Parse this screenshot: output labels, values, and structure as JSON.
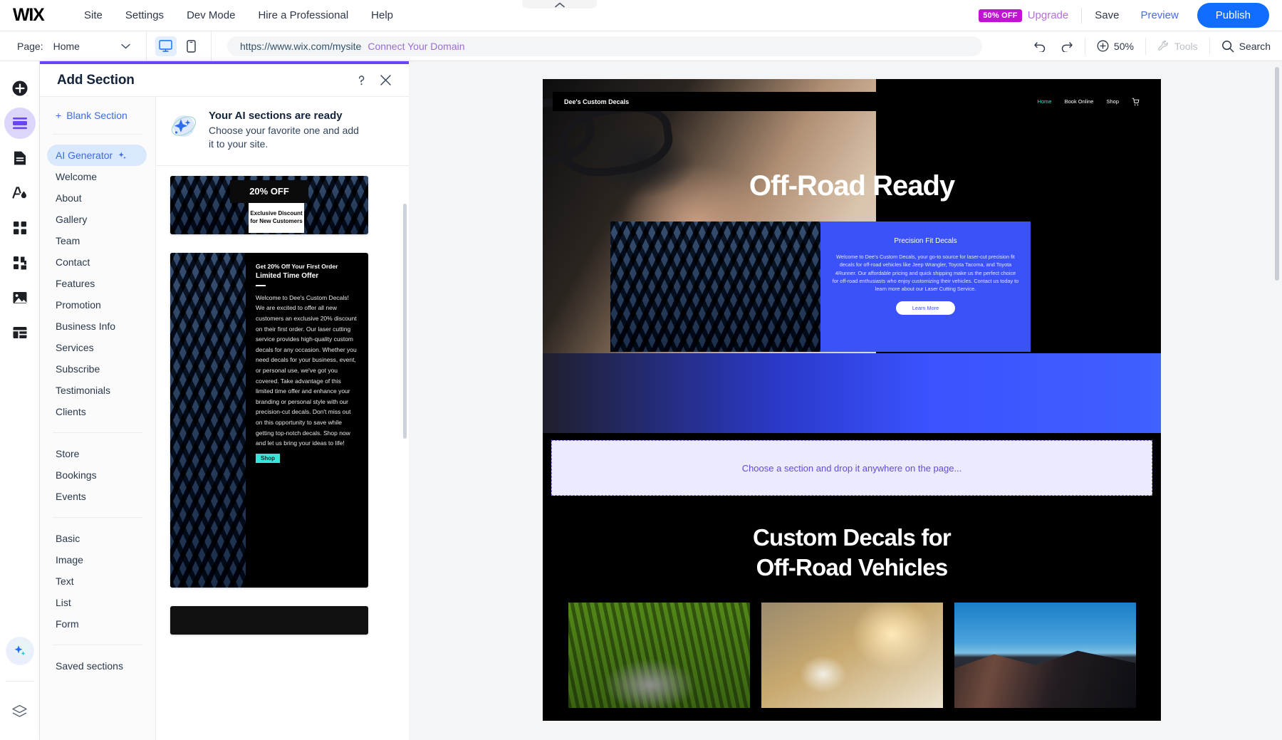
{
  "topbar": {
    "logo": "WIX",
    "menu": [
      "Site",
      "Settings",
      "Dev Mode",
      "Hire a Professional",
      "Help"
    ],
    "discount_badge": "50% OFF",
    "upgrade": "Upgrade",
    "save": "Save",
    "preview": "Preview",
    "publish": "Publish"
  },
  "subbar": {
    "page_label": "Page:",
    "page_value": "Home",
    "url": "https://www.wix.com/mysite",
    "connect_domain": "Connect Your Domain",
    "zoom": "50%",
    "tools": "Tools",
    "search": "Search"
  },
  "rail": {
    "items": [
      {
        "name": "add-icon"
      },
      {
        "name": "sections-icon"
      },
      {
        "name": "pages-icon"
      },
      {
        "name": "design-icon"
      },
      {
        "name": "apps-icon"
      },
      {
        "name": "integrations-icon"
      },
      {
        "name": "media-icon"
      },
      {
        "name": "cms-icon"
      }
    ],
    "ai_icon": "ai-sparkle-icon",
    "layers_icon": "layers-icon"
  },
  "panel": {
    "title": "Add Section",
    "help_icon": "question-mark-icon",
    "close_icon": "close-icon",
    "blank_section": "Blank Section",
    "nav_groups": [
      [
        "AI Generator",
        "Welcome",
        "About",
        "Gallery",
        "Team",
        "Contact",
        "Features",
        "Promotion",
        "Business Info",
        "Services",
        "Subscribe",
        "Testimonials",
        "Clients"
      ],
      [
        "Store",
        "Bookings",
        "Events"
      ],
      [
        "Basic",
        "Image",
        "Text",
        "List",
        "Form"
      ],
      [
        "Saved sections"
      ]
    ],
    "active_nav": "AI Generator",
    "banner": {
      "title": "Your AI sections are ready",
      "subtitle": "Choose your favorite one and add it to your site.",
      "icon": "ai-orbit-sparkle-icon"
    },
    "cards": [
      {
        "id": "card-20-off",
        "headline": "20% OFF",
        "subtext": "Exclusive Discount for New Customers"
      },
      {
        "id": "card-limited-time-offer",
        "eyebrow": "Get 20% Off Your First Order",
        "headline": "Limited Time Offer",
        "body": "Welcome to Dee's Custom Decals! We are excited to offer all new customers an exclusive 20% discount on their first order. Our laser cutting service provides high-quality custom decals for any occasion. Whether you need decals for your business, event, or personal use, we've got you covered. Take advantage of this limited time offer and enhance your branding or personal style with our precision-cut decals. Don't miss out on this opportunity to save while getting top-notch decals. Shop now and let us bring your ideas to life!",
        "button": "Shop"
      },
      {
        "id": "card-third-partial"
      }
    ]
  },
  "site": {
    "brand": "Dee's Custom Decals",
    "nav": [
      "Home",
      "Book Online",
      "Shop"
    ],
    "nav_active": "Home",
    "cart_icon": "cart-icon",
    "hero_title": "Off-Road Ready",
    "blue_card": {
      "title": "Precision Fit Decals",
      "body": "Welcome to Dee's Custom Decals, your go-to source for laser-cut precision fit decals for off-road vehicles like Jeep Wrangler, Toyota Tacoma, and Toyota 4Runner. Our affordable pricing and quick shipping make us the perfect choice for off-road enthusiasts who enjoy customizing their vehicles. Contact us today to learn more about our Laser Cutting Service.",
      "button": "Learn More"
    },
    "dropzone_text": "Choose a section and drop it anywhere on the page...",
    "lower_heading_line1": "Custom Decals for",
    "lower_heading_line2": "Off-Road Vehicles",
    "gallery": [
      "rhino-photo",
      "jeep-headlight-photo",
      "canyon-sunset-photo"
    ]
  },
  "colors": {
    "accent_blue": "#116dff",
    "link_blue": "#3b6be0",
    "purple_bar": "#6a45f5",
    "badge_magenta": "#c112d6",
    "site_blue": "#3a52f8",
    "dropzone_purple": "#5e4ce0"
  }
}
